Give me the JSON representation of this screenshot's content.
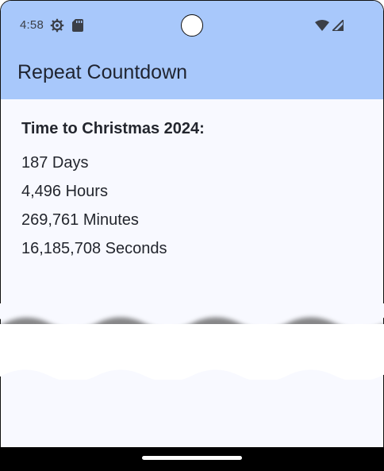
{
  "status_bar": {
    "time": "4:58",
    "icons": [
      "settings-icon",
      "sd-card-icon",
      "wifi-icon",
      "signal-icon"
    ]
  },
  "app_bar": {
    "title": "Repeat Countdown",
    "color": "#a8c8fb"
  },
  "countdown": {
    "heading": "Time to Christmas 2024:",
    "days": "187 Days",
    "hours": "4,496 Hours",
    "minutes": "269,761 Minutes",
    "seconds": "16,185,708 Seconds"
  }
}
